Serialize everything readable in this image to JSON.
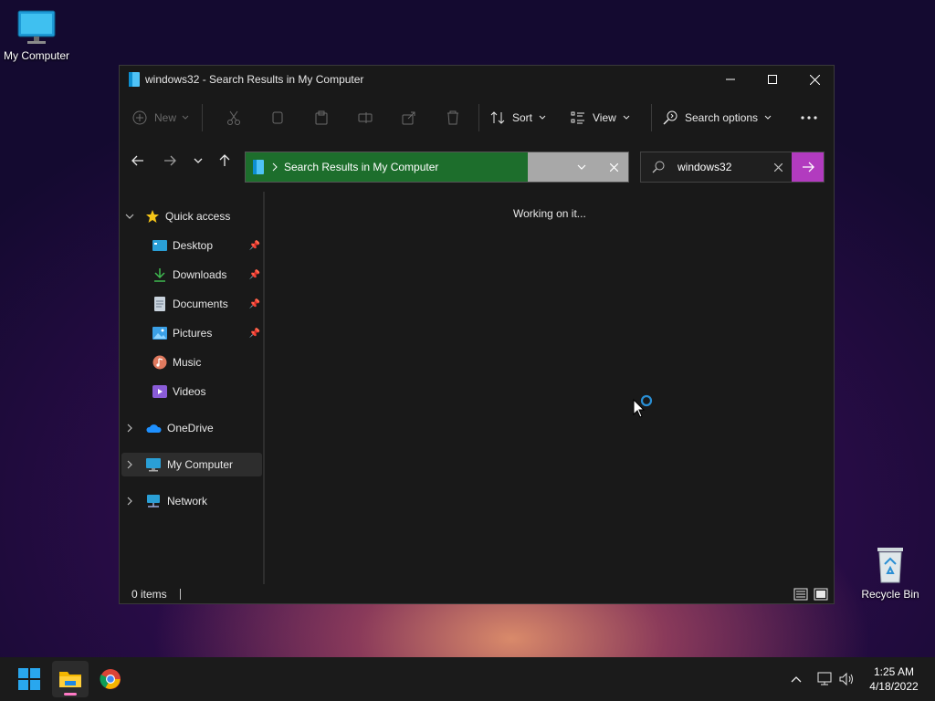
{
  "desktop": {
    "icons": [
      {
        "label": "My Computer"
      },
      {
        "label": "Recycle Bin"
      }
    ]
  },
  "window": {
    "title": "windows32 - Search Results in My Computer",
    "controls": {
      "minimize": "minimize-icon",
      "maximize": "maximize-icon",
      "close": "close-icon"
    }
  },
  "toolbar": {
    "new_label": "New",
    "sort_label": "Sort",
    "view_label": "View",
    "search_options_label": "Search options"
  },
  "address": {
    "path": "Search Results in My Computer"
  },
  "search": {
    "value": "windows32"
  },
  "sidebar": {
    "quick_access": "Quick access",
    "items": [
      {
        "label": "Desktop",
        "pinned": true
      },
      {
        "label": "Downloads",
        "pinned": true
      },
      {
        "label": "Documents",
        "pinned": true
      },
      {
        "label": "Pictures",
        "pinned": true
      },
      {
        "label": "Music",
        "pinned": false
      },
      {
        "label": "Videos",
        "pinned": false
      }
    ],
    "onedrive": "OneDrive",
    "my_computer": "My Computer",
    "network": "Network"
  },
  "content": {
    "message": "Working on it..."
  },
  "status": {
    "items_count": "0 items"
  },
  "taskbar": {
    "time": "1:25 AM",
    "date": "4/18/2022"
  },
  "colors": {
    "address_progress": "#1d6e2c",
    "search_go": "#b23bbf",
    "taskbar_bg": "#1b1b1b",
    "window_bg": "#191919"
  }
}
